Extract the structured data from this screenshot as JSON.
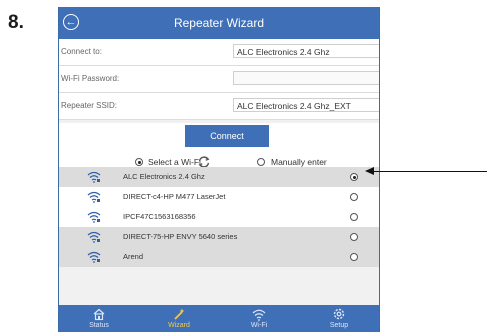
{
  "step_label": "8.",
  "titlebar": {
    "title": "Repeater Wizard",
    "back_icon": "arrow-left-circle-icon"
  },
  "form": {
    "connect_to": {
      "label": "Connect to:",
      "value": "ALC Electronics 2.4 Ghz"
    },
    "wifi_password": {
      "label": "Wi-Fi Password:",
      "value": ""
    },
    "repeater_ssid": {
      "label": "Repeater SSID:",
      "value": "ALC Electronics 2.4 Ghz_EXT"
    }
  },
  "connect_button_label": "Connect",
  "mode": {
    "select_label": "Select a Wi-Fi",
    "select_selected": true,
    "manual_label": "Manually enter",
    "manual_selected": false
  },
  "networks": [
    {
      "ssid": "ALC Electronics 2.4 Ghz",
      "selected": true
    },
    {
      "ssid": "DIRECT-c4-HP M477 LaserJet",
      "selected": false
    },
    {
      "ssid": "IPCF47C1563168356",
      "selected": false
    },
    {
      "ssid": "DIRECT-75-HP ENVY 5640 series",
      "selected": false
    },
    {
      "ssid": "Arend",
      "selected": false
    }
  ],
  "tabs": [
    {
      "label": "Status",
      "icon": "home-icon",
      "active": false
    },
    {
      "label": "Wizard",
      "icon": "magic-wand-icon",
      "active": true
    },
    {
      "label": "Wi-Fi",
      "icon": "wifi-icon",
      "active": false
    },
    {
      "label": "Setup",
      "icon": "gear-icon",
      "active": false
    }
  ],
  "colors": {
    "accent": "#3f6fb6",
    "active_tab": "#f2c94c",
    "row_shade": "#dcdcdc"
  }
}
